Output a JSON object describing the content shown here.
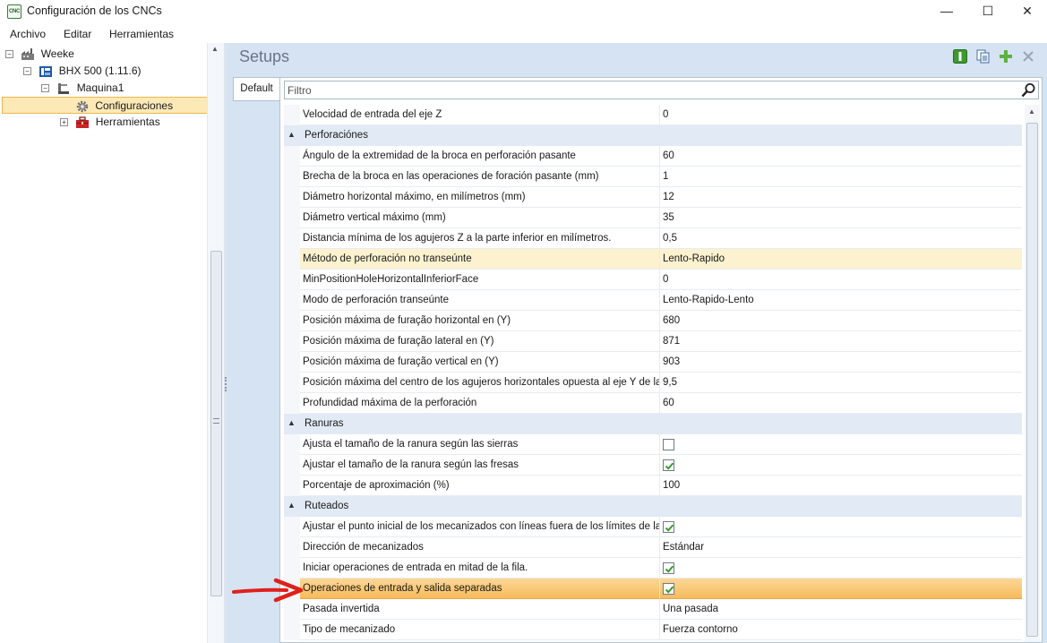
{
  "window": {
    "title": "Configuración de los CNCs",
    "app_icon_text": "CNC",
    "minimize": "—",
    "maximize": "☐",
    "close": "✕"
  },
  "menu": [
    "Archivo",
    "Editar",
    "Herramientas"
  ],
  "tree": {
    "nodes": [
      {
        "label": "Weeke",
        "toggle": "−",
        "icon": "factory-icon"
      },
      {
        "label": "BHX 500 (1.11.6)",
        "toggle": "−",
        "icon": "cnc-machine-icon"
      },
      {
        "label": "Maquina1",
        "toggle": "−",
        "icon": "machine-icon"
      },
      {
        "label": "Configuraciones",
        "toggle": "",
        "icon": "gear-icon",
        "selected": true
      },
      {
        "label": "Herramientas",
        "toggle": "+",
        "icon": "toolbox-icon"
      }
    ]
  },
  "setups": {
    "title": "Setups",
    "tab": "Default",
    "filter_placeholder": "Filtro",
    "rows": [
      {
        "type": "prop",
        "name": "Velocidad de entrada del eje Z",
        "value": "0"
      },
      {
        "type": "cat",
        "name": "Perforaciónes",
        "arrow": "▲"
      },
      {
        "type": "prop",
        "name": "Ángulo de la extremidad de la broca en perforación pasante",
        "value": "60"
      },
      {
        "type": "prop",
        "name": "Brecha de la broca en las operaciones de foración pasante (mm)",
        "value": "1"
      },
      {
        "type": "prop",
        "name": "Diámetro horizontal máximo, en milímetros (mm)",
        "value": "12"
      },
      {
        "type": "prop",
        "name": "Diámetro vertical máximo (mm)",
        "value": "35"
      },
      {
        "type": "prop",
        "name": "Distancia mínima de los agujeros Z a la parte inferior en milímetros.",
        "value": "0,5"
      },
      {
        "type": "prop",
        "name": "Método de perforación no transeúnte",
        "value": "Lento-Rapido",
        "highlight": "soft"
      },
      {
        "type": "prop",
        "name": "MinPositionHoleHorizontalInferiorFace",
        "value": "0"
      },
      {
        "type": "prop",
        "name": "Modo de perforación transeúnte",
        "value": "Lento-Rapido-Lento"
      },
      {
        "type": "prop",
        "name": "Posición máxima de furação horizontal en (Y)",
        "value": "680"
      },
      {
        "type": "prop",
        "name": "Posición máxima de furação lateral en (Y)",
        "value": "871"
      },
      {
        "type": "prop",
        "name": "Posición máxima de furação vertical en (Y)",
        "value": "903"
      },
      {
        "type": "prop",
        "name": "Posición máxima del centro de los agujeros horizontales opuesta al eje Y de la...",
        "value": "9,5"
      },
      {
        "type": "prop",
        "name": "Profundidad máxima de la perforación",
        "value": "60"
      },
      {
        "type": "cat",
        "name": "Ranuras",
        "arrow": "▲"
      },
      {
        "type": "prop",
        "name": "Ajusta el tamaño de la ranura según las sierras",
        "checkbox": true,
        "checked": false
      },
      {
        "type": "prop",
        "name": "Ajustar el tamaño de la ranura según las fresas",
        "checkbox": true,
        "checked": true
      },
      {
        "type": "prop",
        "name": "Porcentaje de aproximación (%)",
        "value": "100"
      },
      {
        "type": "cat",
        "name": "Ruteados",
        "arrow": "▲"
      },
      {
        "type": "prop",
        "name": "Ajustar el punto inicial de los mecanizados con líneas fuera de los límites de la...",
        "checkbox": true,
        "checked": true
      },
      {
        "type": "prop",
        "name": "Dirección de mecanizados",
        "value": "Estándar"
      },
      {
        "type": "prop",
        "name": "Iniciar operaciones de entrada en mitad de la fila.",
        "checkbox": true,
        "checked": true
      },
      {
        "type": "prop",
        "name": "Operaciones de entrada y salida separadas",
        "checkbox": true,
        "checked": true,
        "highlight": "strong"
      },
      {
        "type": "prop",
        "name": "Pasada invertida",
        "value": "Una pasada"
      },
      {
        "type": "prop",
        "name": "Tipo de mecanizado",
        "value": "Fuerza contorno"
      }
    ]
  },
  "colors": {
    "accent_green": "#3b9a2f",
    "highlight_orange": "#f6bb5b",
    "highlight_soft": "#fcf2cf",
    "arrow_red": "#e0201b"
  }
}
